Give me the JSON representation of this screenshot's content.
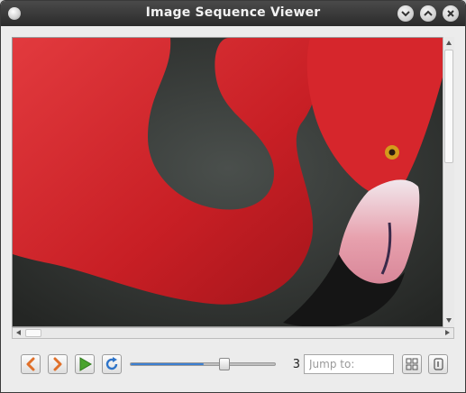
{
  "window": {
    "title": "Image Sequence Viewer"
  },
  "viewer": {
    "image_label": "flamingo-image",
    "colors": {
      "background": "#2b2b2b",
      "feather": "#d0252a",
      "beak_tip": "#1a1a1a",
      "beak_light": "#e9dde3"
    }
  },
  "controls": {
    "prev_icon": "chevron-left-icon",
    "next_icon": "chevron-right-icon",
    "play_icon": "play-icon",
    "loop_icon": "refresh-icon",
    "frame_position": 0.5,
    "frame_number": "3",
    "jump_placeholder": "Jump to:",
    "grid_icon": "grid-icon",
    "info_icon": "info-icon"
  },
  "colors": {
    "accent": "#3c7fd1",
    "nav_orange": "#e0702a",
    "play_green": "#4aa32e"
  }
}
